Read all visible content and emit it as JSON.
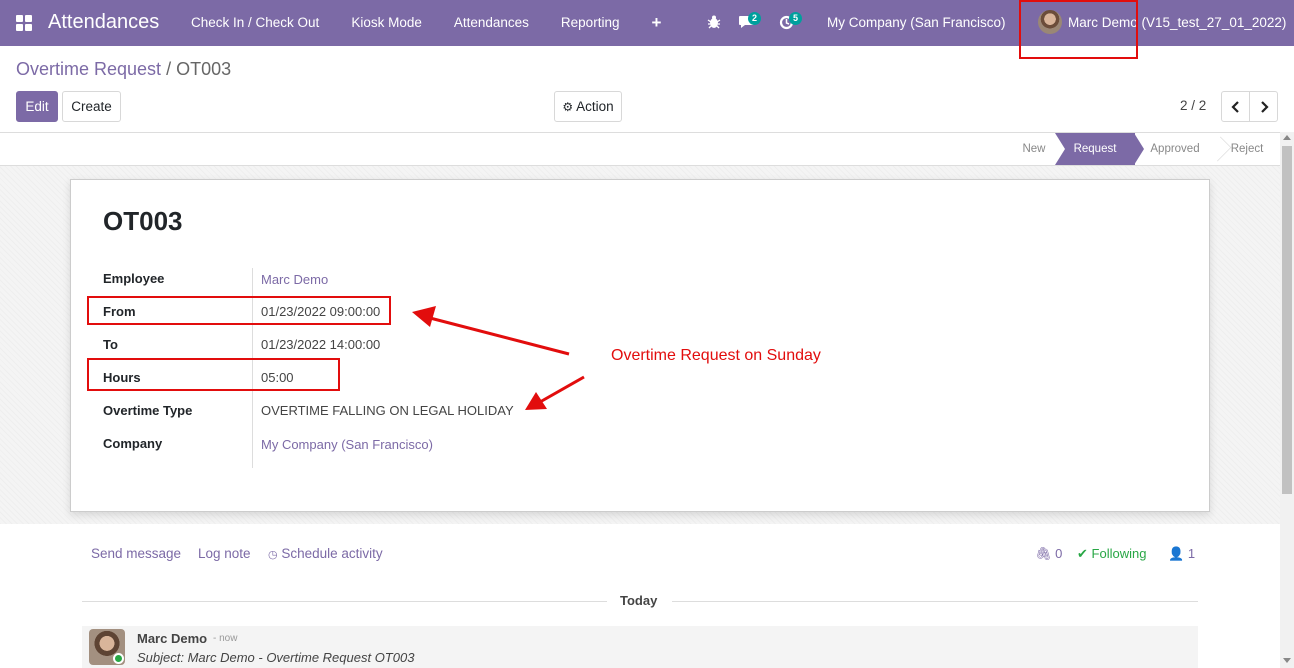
{
  "navbar": {
    "app_title": "Attendances",
    "menu": [
      "Check In / Check Out",
      "Kiosk Mode",
      "Attendances",
      "Reporting"
    ],
    "plus_icon": "plus-icon",
    "messages_count": "2",
    "activities_count": "5",
    "company": "My Company (San Francisco)",
    "user": "Marc Demo (V15_test_27_01_2022)",
    "color": "#7c6aa6"
  },
  "breadcrumb": {
    "parent": "Overtime Request",
    "separator": "/",
    "current": "OT003"
  },
  "toolbar": {
    "edit": "Edit",
    "create": "Create",
    "action": "Action",
    "action_icon": "gear-icon",
    "pager": "2 / 2"
  },
  "statusbar": {
    "stages": [
      "New",
      "Request",
      "Approved",
      "Reject"
    ],
    "active": "Request"
  },
  "record": {
    "title": "OT003",
    "fields": [
      {
        "label": "Employee",
        "value": "Marc Demo",
        "link": true
      },
      {
        "label": "From",
        "value": "01/23/2022 09:00:00",
        "link": false
      },
      {
        "label": "To",
        "value": "01/23/2022 14:00:00",
        "link": false
      },
      {
        "label": "Hours",
        "value": "05:00",
        "link": false
      },
      {
        "label": "Overtime Type",
        "value": "OVERTIME FALLING ON LEGAL HOLIDAY",
        "link": false
      },
      {
        "label": "Company",
        "value": "My Company (San Francisco)",
        "link": true
      }
    ]
  },
  "annotation": {
    "text": "Overtime Request on Sunday",
    "color": "#e20d0d"
  },
  "chatter": {
    "send_message": "Send message",
    "log_note": "Log note",
    "schedule_activity": "Schedule activity",
    "attachments": "0",
    "following": "Following",
    "followers": "1",
    "date_separator": "Today",
    "message": {
      "author": "Marc Demo",
      "time": "- now",
      "subject": "Subject: Marc Demo - Overtime Request OT003"
    }
  }
}
